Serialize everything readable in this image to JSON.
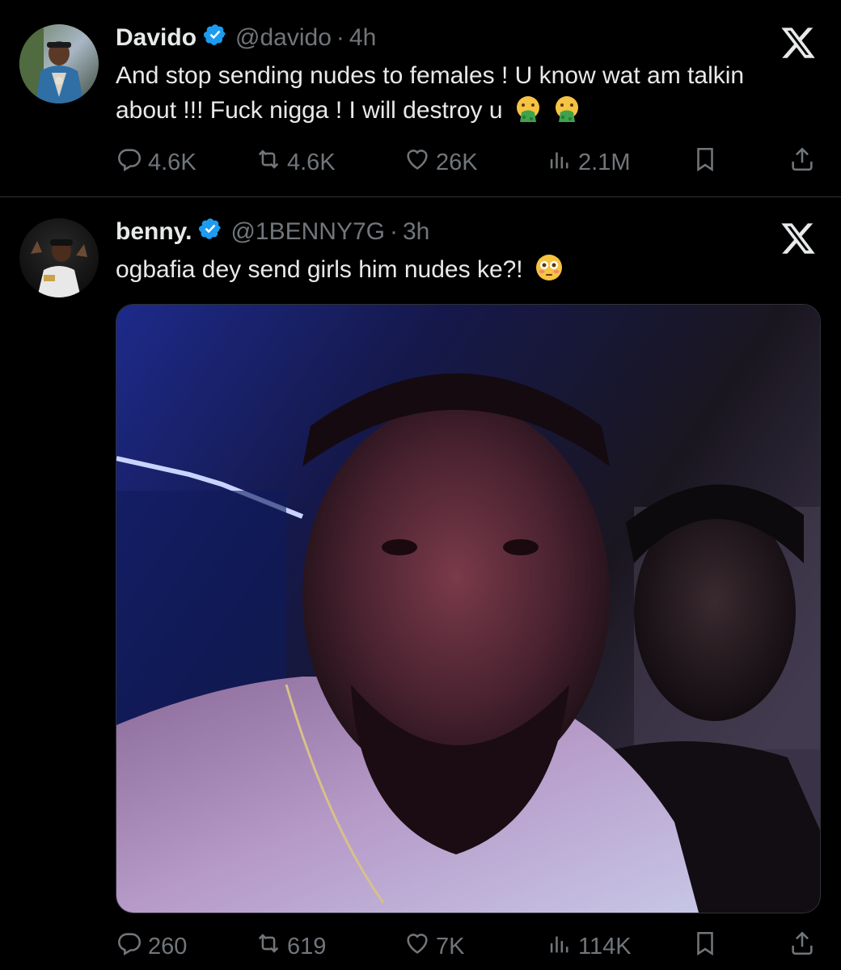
{
  "tweets": [
    {
      "name": "Davido",
      "handle": "@davido",
      "dot": "·",
      "time": "4h",
      "text": "And stop sending nudes to females ! U know wat am talkin about !!! Fuck nigga ! I will destroy u",
      "emoji_icons": [
        "vomiting-face-icon",
        "vomiting-face-icon"
      ],
      "stats": {
        "replies": "4.6K",
        "reposts": "4.6K",
        "likes": "26K",
        "views": "2.1M"
      }
    },
    {
      "name": "benny.",
      "handle": "@1BENNY7G",
      "dot": "·",
      "time": "3h",
      "text": "ogbafia dey send girls him nudes ke?!",
      "emoji_icons": [
        "flushed-face-icon"
      ],
      "stats": {
        "replies": "260",
        "reposts": "619",
        "likes": "7K",
        "views": "114K"
      }
    }
  ],
  "colors": {
    "background": "#000000",
    "text": "#e7e9ea",
    "secondary": "#71767b",
    "verified": "#1d9bf0",
    "divider": "#2f3336"
  }
}
